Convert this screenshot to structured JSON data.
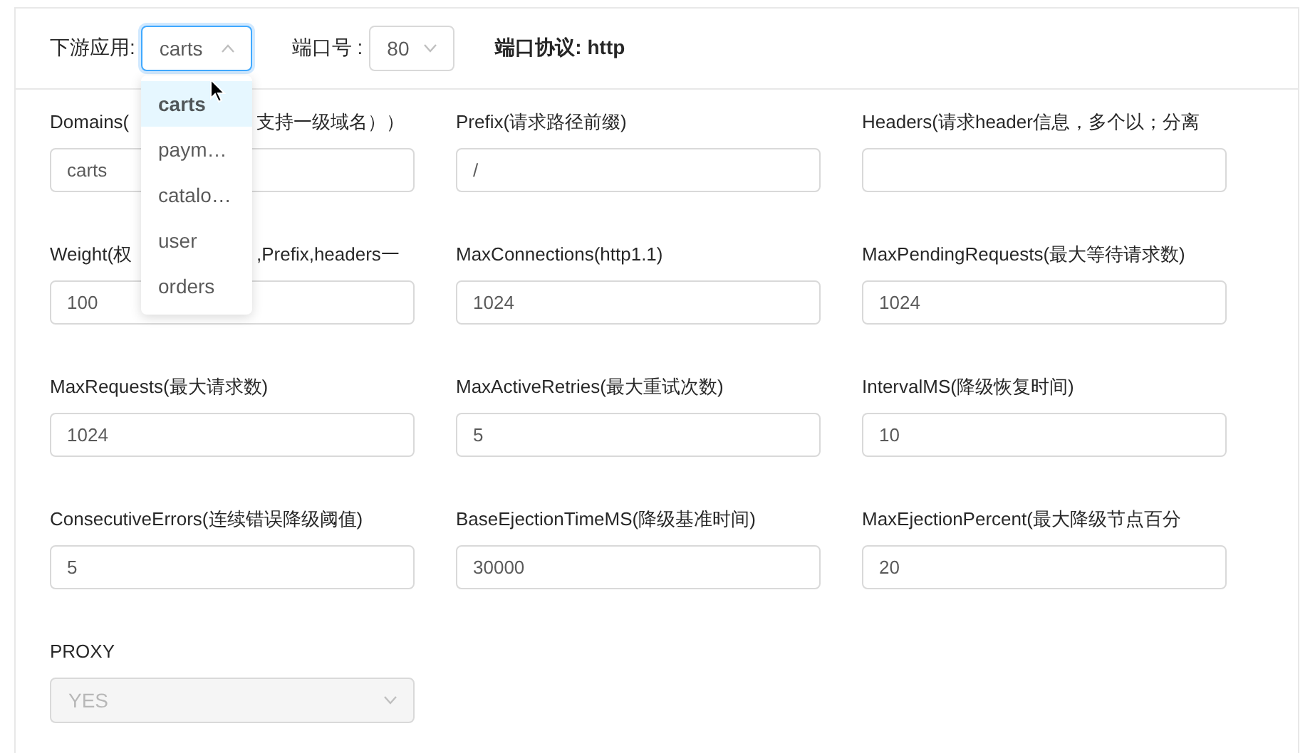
{
  "header": {
    "app_label": "下游应用:",
    "app_select": {
      "value": "carts",
      "open": true
    },
    "port_label": "端口号 :",
    "port_select": {
      "value": "80",
      "open": false
    },
    "protocol": "端口协议: http"
  },
  "dropdown": {
    "options": [
      {
        "label": "carts",
        "selected": true
      },
      {
        "label": "paym…",
        "selected": false
      },
      {
        "label": "catalo…",
        "selected": false
      },
      {
        "label": "user",
        "selected": false
      },
      {
        "label": "orders",
        "selected": false
      }
    ]
  },
  "fields": [
    {
      "kind": "input",
      "label_parts": [
        "Domains(",
        "支持一级域名））"
      ],
      "value": "carts"
    },
    {
      "kind": "input",
      "label": "Prefix(请求路径前缀)",
      "value": "/"
    },
    {
      "kind": "input",
      "label": "Headers(请求header信息，多个以；分离"
    },
    {
      "kind": "input",
      "label_parts": [
        "Weight(权",
        ",Prefix,headers一"
      ],
      "value": "100"
    },
    {
      "kind": "input",
      "label": "MaxConnections(http1.1)",
      "value": "1024"
    },
    {
      "kind": "input",
      "label": "MaxPendingRequests(最大等待请求数)",
      "value": "1024"
    },
    {
      "kind": "input",
      "label": "MaxRequests(最大请求数)",
      "value": "1024"
    },
    {
      "kind": "input",
      "label": "MaxActiveRetries(最大重试次数)",
      "value": "5"
    },
    {
      "kind": "input",
      "label": "IntervalMS(降级恢复时间)",
      "value": "10"
    },
    {
      "kind": "input",
      "label": "ConsecutiveErrors(连续错误降级阈值)",
      "value": "5"
    },
    {
      "kind": "input",
      "label": "BaseEjectionTimeMS(降级基准时间)",
      "value": "30000"
    },
    {
      "kind": "input",
      "label": "MaxEjectionPercent(最大降级节点百分",
      "value": "20"
    },
    {
      "kind": "select",
      "label": "PROXY",
      "value": "YES",
      "disabled": true
    }
  ]
}
